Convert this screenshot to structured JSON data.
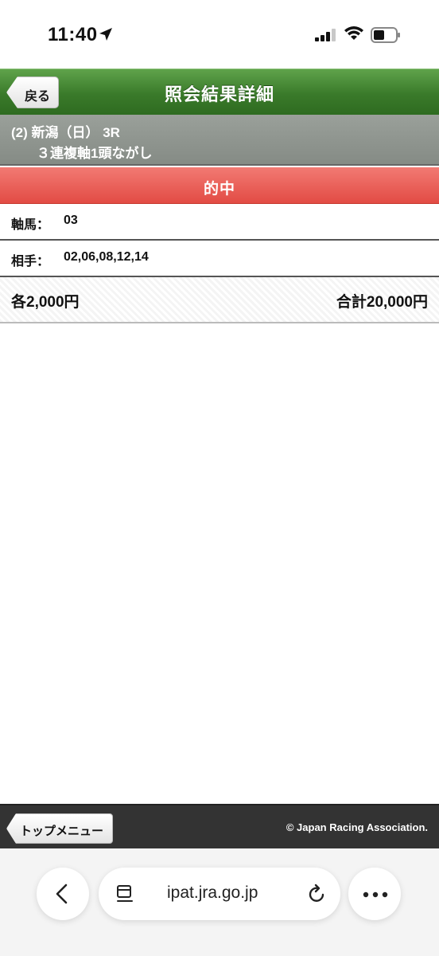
{
  "status_bar": {
    "time": "11:40"
  },
  "header": {
    "back_label": "戻る",
    "title": "照会結果詳細"
  },
  "race": {
    "line1": "(2) 新潟（日） 3R",
    "line2": "３連複軸1頭ながし"
  },
  "result": {
    "label": "的中"
  },
  "details": {
    "axis_label": "軸馬：",
    "axis_value": "03",
    "partner_label": "相手：",
    "partner_value": "02,06,08,12,14"
  },
  "amount": {
    "each": "各2,000円",
    "total": "合計20,000円"
  },
  "footer": {
    "top_menu_label": "トップメニュー",
    "copyright": "© Japan Racing Association."
  },
  "browser": {
    "url": "ipat.jra.go.jp"
  },
  "colors": {
    "header_green": "#3a7a2a",
    "race_gray": "#8a908a",
    "hit_red": "#e85a52",
    "footer_dark": "#333333"
  }
}
